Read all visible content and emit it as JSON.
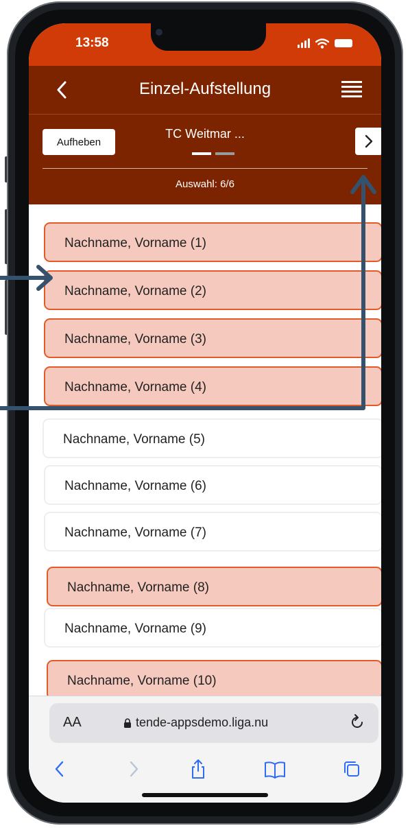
{
  "status_bar": {
    "time": "13:58"
  },
  "header": {
    "title": "Einzel-Aufstellung"
  },
  "team_bar": {
    "clear_button": "Aufheben",
    "team_name": "TC Weitmar ...",
    "selection": "Auswahl: 6/6"
  },
  "players": [
    {
      "label": "Nachname, Vorname (1)",
      "selected": true
    },
    {
      "label": "Nachname, Vorname (2)",
      "selected": true
    },
    {
      "label": "Nachname, Vorname (3)",
      "selected": true
    },
    {
      "label": "Nachname, Vorname (4)",
      "selected": true
    },
    {
      "label": "Nachname, Vorname (5)",
      "selected": false
    },
    {
      "label": "Nachname, Vorname (6)",
      "selected": false
    },
    {
      "label": "Nachname, Vorname (7)",
      "selected": false
    },
    {
      "label": "Nachname, Vorname (8)",
      "selected": true
    },
    {
      "label": "Nachname, Vorname (9)",
      "selected": false
    },
    {
      "label": "Nachname, Vorname (10)",
      "selected": true
    }
  ],
  "browser": {
    "text_size_label": "AA",
    "url": "tende-appsdemo.liga.nu"
  },
  "colors": {
    "status_bar": "#d13b07",
    "header": "#7c2400",
    "selected_row_fill": "#f5c9be",
    "selected_row_border": "#e05a2a",
    "annotation_arrow": "#34526d",
    "ios_blue": "#2f6cf6"
  },
  "icons": [
    "back-icon",
    "menu-icon",
    "chevron-right-icon",
    "lock-icon",
    "reload-icon",
    "share-icon",
    "bookmarks-icon",
    "tabs-icon"
  ]
}
